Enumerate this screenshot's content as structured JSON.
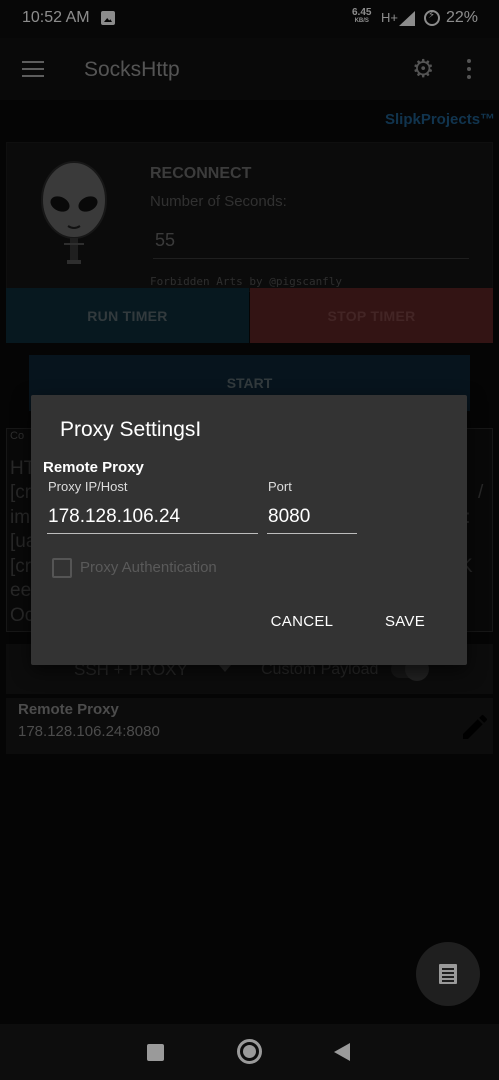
{
  "status_bar": {
    "time": "10:52 AM",
    "speed_value": "6.45",
    "speed_unit": "KB/S",
    "network": "H+",
    "battery": "22%",
    "icons": [
      "image-icon",
      "signal-icon",
      "battery-charging-icon"
    ]
  },
  "app_bar": {
    "title": "SocksHttp",
    "icons": [
      "menu-icon",
      "gear-icon",
      "more-vert-icon"
    ]
  },
  "brand": "SlipkProjects™",
  "timer": {
    "title": "RECONNECT",
    "seconds_label": "Number of Seconds:",
    "seconds_value": "55",
    "credit": "Forbidden Arts by @pigscanfly",
    "run_label": "RUN TIMER",
    "stop_label": "STOP TIMER"
  },
  "start_label": "START",
  "config": {
    "label": "Co",
    "lines": [
      "HT",
      "[cr",
      "im",
      "[ua",
      "[cr",
      "ee",
      "Oc"
    ],
    "right_fragments": [
      "/",
      "t:",
      "K"
    ]
  },
  "mode": {
    "selected": "SSH + PROXY",
    "payload_label": "Custom Payload",
    "payload_enabled": false
  },
  "remote_proxy": {
    "title": "Remote Proxy",
    "value": "178.128.106.24:8080"
  },
  "dialog": {
    "title": "Proxy SettingsI",
    "section": "Remote Proxy",
    "host_label": "Proxy IP/Host",
    "host_value": "178.128.106.24",
    "port_label": "Port",
    "port_value": "8080",
    "auth_label": "Proxy Authentication",
    "auth_checked": false,
    "cancel_label": "CANCEL",
    "save_label": "SAVE"
  },
  "fab_icon": "log-icon",
  "nav_icons": [
    "recents-icon",
    "home-icon",
    "back-icon"
  ],
  "colors": {
    "accent_dark": "#0d2d3a",
    "stop_red": "#5e2626",
    "dialog_bg": "#333333",
    "brand_blue": "#1f5f8f"
  }
}
